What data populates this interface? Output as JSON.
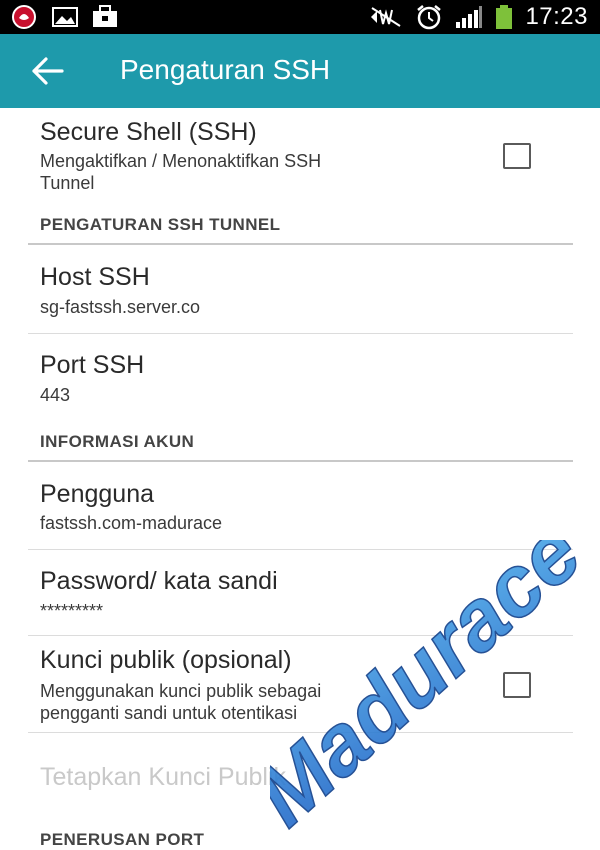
{
  "status_bar": {
    "time": "17:23",
    "icons": [
      "notification-icon",
      "image-icon",
      "briefcase-icon",
      "mute-icon",
      "alarm-icon",
      "signal-icon",
      "battery-icon"
    ]
  },
  "app_bar": {
    "title": "Pengaturan SSH",
    "back_icon": "arrow-back-icon",
    "background": "#1e9aab"
  },
  "ssh_toggle": {
    "title": "Secure Shell (SSH)",
    "summary_line1": "Mengaktifkan / Menonaktifkan SSH",
    "summary_line2": "Tunnel",
    "checked": false
  },
  "tunnel_section": {
    "header": "PENGATURAN SSH TUNNEL",
    "host": {
      "title": "Host SSH",
      "value": "sg-fastssh.server.co"
    },
    "port": {
      "title": "Port SSH",
      "value": "443"
    }
  },
  "account_section": {
    "header": "INFORMASI AKUN",
    "user": {
      "title": "Pengguna",
      "value": "fastssh.com-madurace"
    },
    "password": {
      "title": "Password/ kata sandi",
      "value": "*********"
    },
    "public_key": {
      "title": "Kunci publik (opsional)",
      "summary_line1": "Menggunakan kunci publik sebagai",
      "summary_line2": "pengganti sandi untuk otentikasi",
      "checked": false
    },
    "set_public_key": {
      "title": "Tetapkan Kunci Publik",
      "enabled": false
    }
  },
  "port_forward_section": {
    "header": "PENERUSAN PORT"
  },
  "watermark": {
    "text": "Madurace",
    "color": "#2f86d6"
  }
}
